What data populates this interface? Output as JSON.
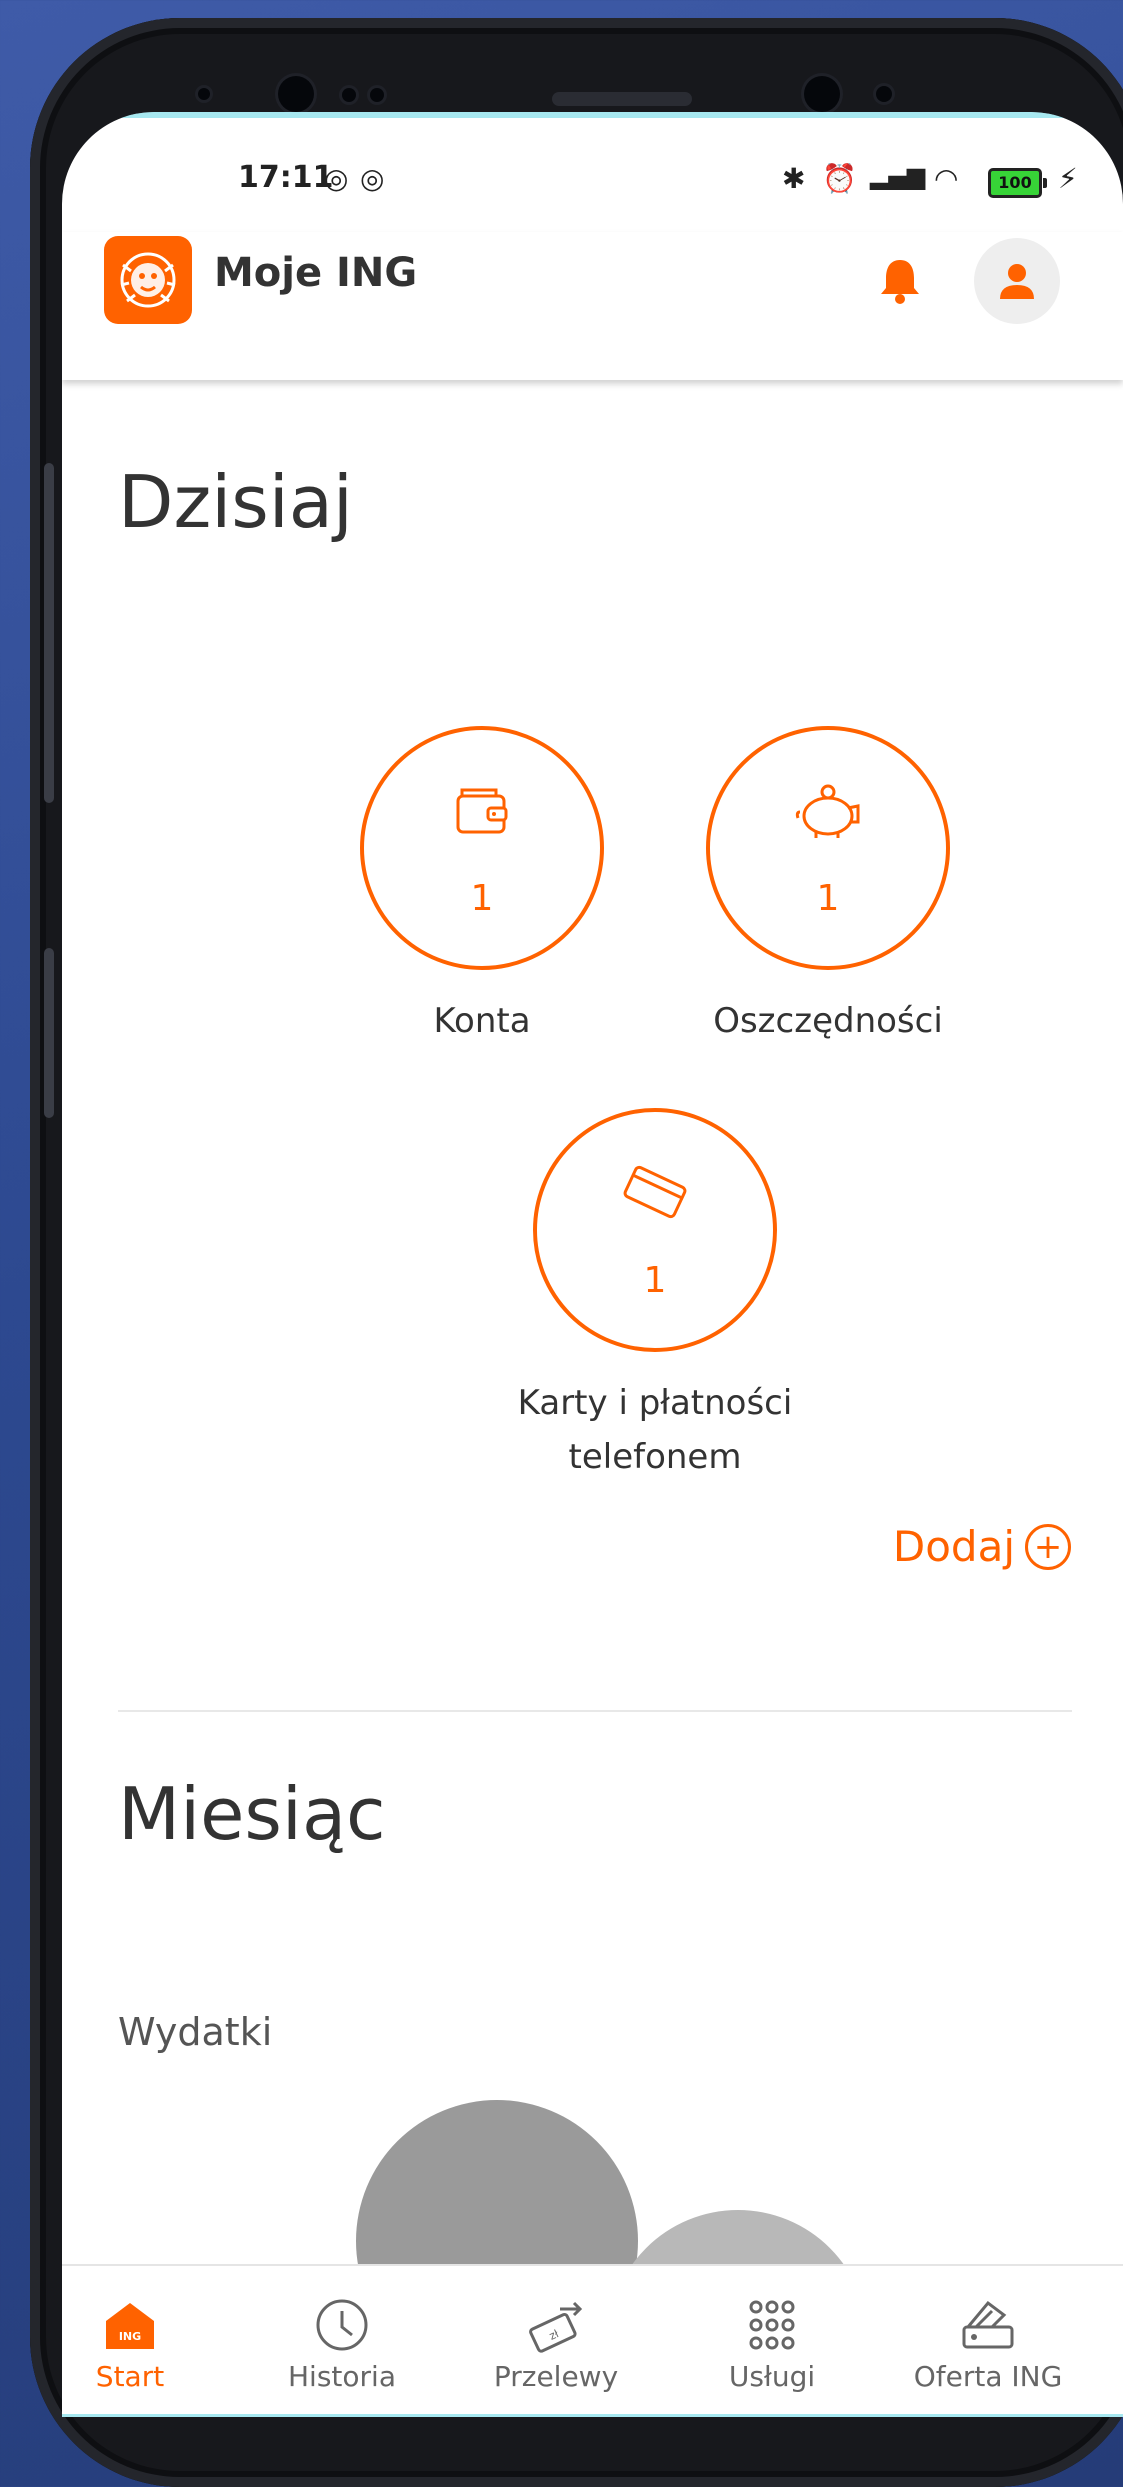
{
  "status_bar": {
    "time": "17:11",
    "battery": "100"
  },
  "header": {
    "app_title": "Moje ING"
  },
  "today": {
    "title": "Dzisiaj",
    "tiles": [
      {
        "label": "Konta",
        "count": "1",
        "icon": "wallet-icon"
      },
      {
        "label": "Oszczędności",
        "count": "1",
        "icon": "piggy-bank-icon"
      },
      {
        "label_line1": "Karty i płatności",
        "label_line2": "telefonem",
        "count": "1",
        "icon": "card-icon"
      }
    ],
    "add_label": "Dodaj"
  },
  "month": {
    "title": "Miesiąc",
    "subtitle": "Wydatki"
  },
  "bottom_nav": [
    {
      "label": "Start",
      "icon": "home-icon",
      "active": true
    },
    {
      "label": "Historia",
      "icon": "clock-icon",
      "active": false
    },
    {
      "label": "Przelewy",
      "icon": "transfer-icon",
      "active": false
    },
    {
      "label": "Usługi",
      "icon": "grid-icon",
      "active": false
    },
    {
      "label": "Oferta ING",
      "icon": "offer-icon",
      "active": false
    }
  ],
  "colors": {
    "accent": "#ff6200",
    "bubble_dark": "#9a9a9a",
    "bubble_light": "#b8b8b8"
  }
}
